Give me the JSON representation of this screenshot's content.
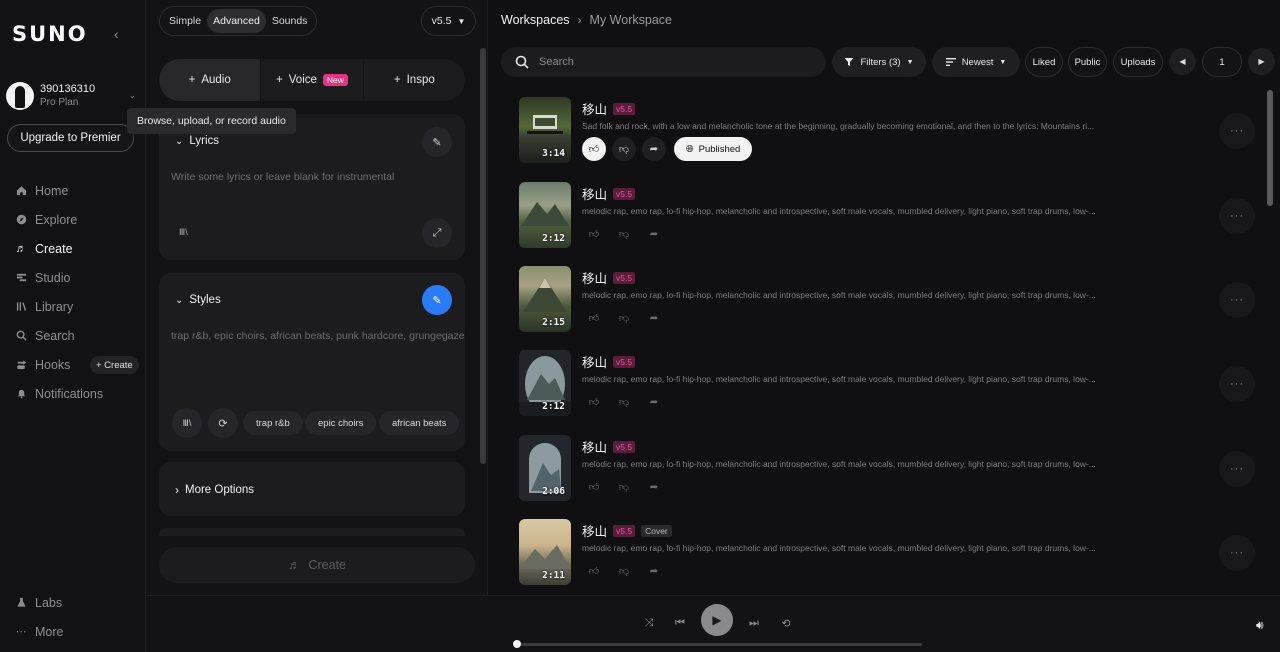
{
  "sidebar": {
    "logo": "SUNO",
    "collapse_icon": "chevron-left-icon",
    "account": {
      "name": "390136310",
      "plan": "Pro Plan"
    },
    "upgrade_label": "Upgrade to Premier",
    "nav": [
      {
        "label": "Home",
        "icon": "home-icon"
      },
      {
        "label": "Explore",
        "icon": "compass-icon"
      },
      {
        "label": "Create",
        "icon": "music-note-icon",
        "active": true
      },
      {
        "label": "Studio",
        "icon": "studio-icon"
      },
      {
        "label": "Library",
        "icon": "library-icon"
      },
      {
        "label": "Search",
        "icon": "search-icon"
      },
      {
        "label": "Hooks",
        "icon": "hooks-icon"
      },
      {
        "label": "Notifications",
        "icon": "bell-icon"
      }
    ],
    "hooks_create": "+ Create",
    "bottom": [
      {
        "label": "Labs",
        "icon": "flask-icon"
      },
      {
        "label": "More",
        "icon": "dots-icon"
      }
    ]
  },
  "tooltip": "Browse, upload, or record audio",
  "create_panel": {
    "modes": [
      "Simple",
      "Advanced",
      "Sounds"
    ],
    "active_mode": "Advanced",
    "version": "v5.5",
    "tabs": [
      {
        "label": "Audio"
      },
      {
        "label": "Voice",
        "badge": "New"
      },
      {
        "label": "Inspo"
      }
    ],
    "lyrics": {
      "title": "Lyrics",
      "placeholder": "Write some lyrics or leave blank for instrumental"
    },
    "styles": {
      "title": "Styles",
      "placeholder": "trap r&b, epic choirs, african beats, punk hardcore, grungegaze",
      "chips": [
        "trap r&b",
        "epic choirs",
        "african beats"
      ]
    },
    "more_options": "More Options",
    "create_label": "Create"
  },
  "workspace": {
    "breadcrumb": [
      "Workspaces",
      "My Workspace"
    ],
    "search_placeholder": "Search",
    "filters_label": "Filters (3)",
    "sort_label": "Newest",
    "toggles": [
      "Liked",
      "Public",
      "Uploads"
    ],
    "page": "1",
    "songs": [
      {
        "title": "移山",
        "version": "v5.5",
        "duration": "3:14",
        "desc": "Sad folk and rock, with a low and melancholic tone at the beginning, gradually becoming emotional, and then to the lyrics: Mountains ri...",
        "published": "Published",
        "liked": true
      },
      {
        "title": "移山",
        "version": "v5.5",
        "duration": "2:12",
        "desc": "melodic rap, emo rap, lo-fi hip-hop, melancholic and introspective, soft male vocals, mumbled delivery, light piano, soft trap drums, low-..."
      },
      {
        "title": "移山",
        "version": "v5.5",
        "duration": "2:15",
        "desc": "melodic rap, emo rap, lo-fi hip-hop, melancholic and introspective, soft male vocals, mumbled delivery, light piano, soft trap drums, low-..."
      },
      {
        "title": "移山",
        "version": "v5.5",
        "duration": "2:12",
        "desc": "melodic rap, emo rap, lo-fi hip-hop, melancholic and introspective, soft male vocals, mumbled delivery, light piano, soft trap drums, low-..."
      },
      {
        "title": "移山",
        "version": "v5.5",
        "duration": "2:06",
        "desc": "melodic rap, emo rap, lo-fi hip-hop, melancholic and introspective, soft male vocals, mumbled delivery, light piano, soft trap drums, low-..."
      },
      {
        "title": "移山",
        "version": "v5.5",
        "duration": "2:11",
        "cover": "Cover",
        "desc": "melodic rap, emo rap, lo-fi hip-hop, melancholic and introspective, soft male vocals, mumbled delivery, light piano, soft trap drums, low-..."
      }
    ]
  },
  "player": {
    "controls": [
      "shuffle-icon",
      "previous-icon",
      "play-icon",
      "next-icon",
      "repeat-icon",
      "volume-icon"
    ],
    "progress": 0
  },
  "colors": {
    "accent_blue": "#2a7bf6",
    "new_badge": "#e5337e",
    "version_badge_bg": "#5a1d3a",
    "version_badge_text": "#e75a94"
  }
}
